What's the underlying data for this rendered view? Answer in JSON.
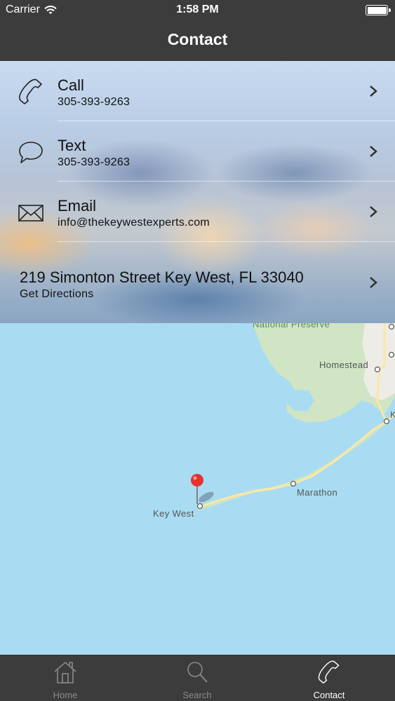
{
  "status_bar": {
    "carrier": "Carrier",
    "time": "1:58 PM"
  },
  "nav": {
    "title": "Contact"
  },
  "contact": {
    "rows": [
      {
        "title": "Call",
        "subtitle": "305-393-9263",
        "icon": "phone-icon"
      },
      {
        "title": "Text",
        "subtitle": "305-393-9263",
        "icon": "chat-bubble-icon"
      },
      {
        "title": "Email",
        "subtitle": "info@thekeywestexperts.com",
        "icon": "envelope-icon"
      }
    ],
    "address": {
      "title": "219 Simonton Street Key West, FL 33040",
      "subtitle": "Get Directions"
    }
  },
  "map": {
    "labels": {
      "preserve": "National Preserve",
      "homestead": "Homestead",
      "marathon": "Marathon",
      "key_west": "Key West",
      "edge_k": "K"
    },
    "colors": {
      "water": "#a9dcf2",
      "land": "#cfe5c4",
      "road": "#fbe7a6",
      "pin": "#e8312f"
    }
  },
  "tabs": [
    {
      "label": "Home",
      "icon": "house-icon",
      "active": false
    },
    {
      "label": "Search",
      "icon": "magnifier-icon",
      "active": false
    },
    {
      "label": "Contact",
      "icon": "phone-icon",
      "active": true
    }
  ],
  "colors": {
    "bar": "#3d3c3d",
    "tab_inactive": "#8a8a8a",
    "tab_active": "#ffffff"
  }
}
